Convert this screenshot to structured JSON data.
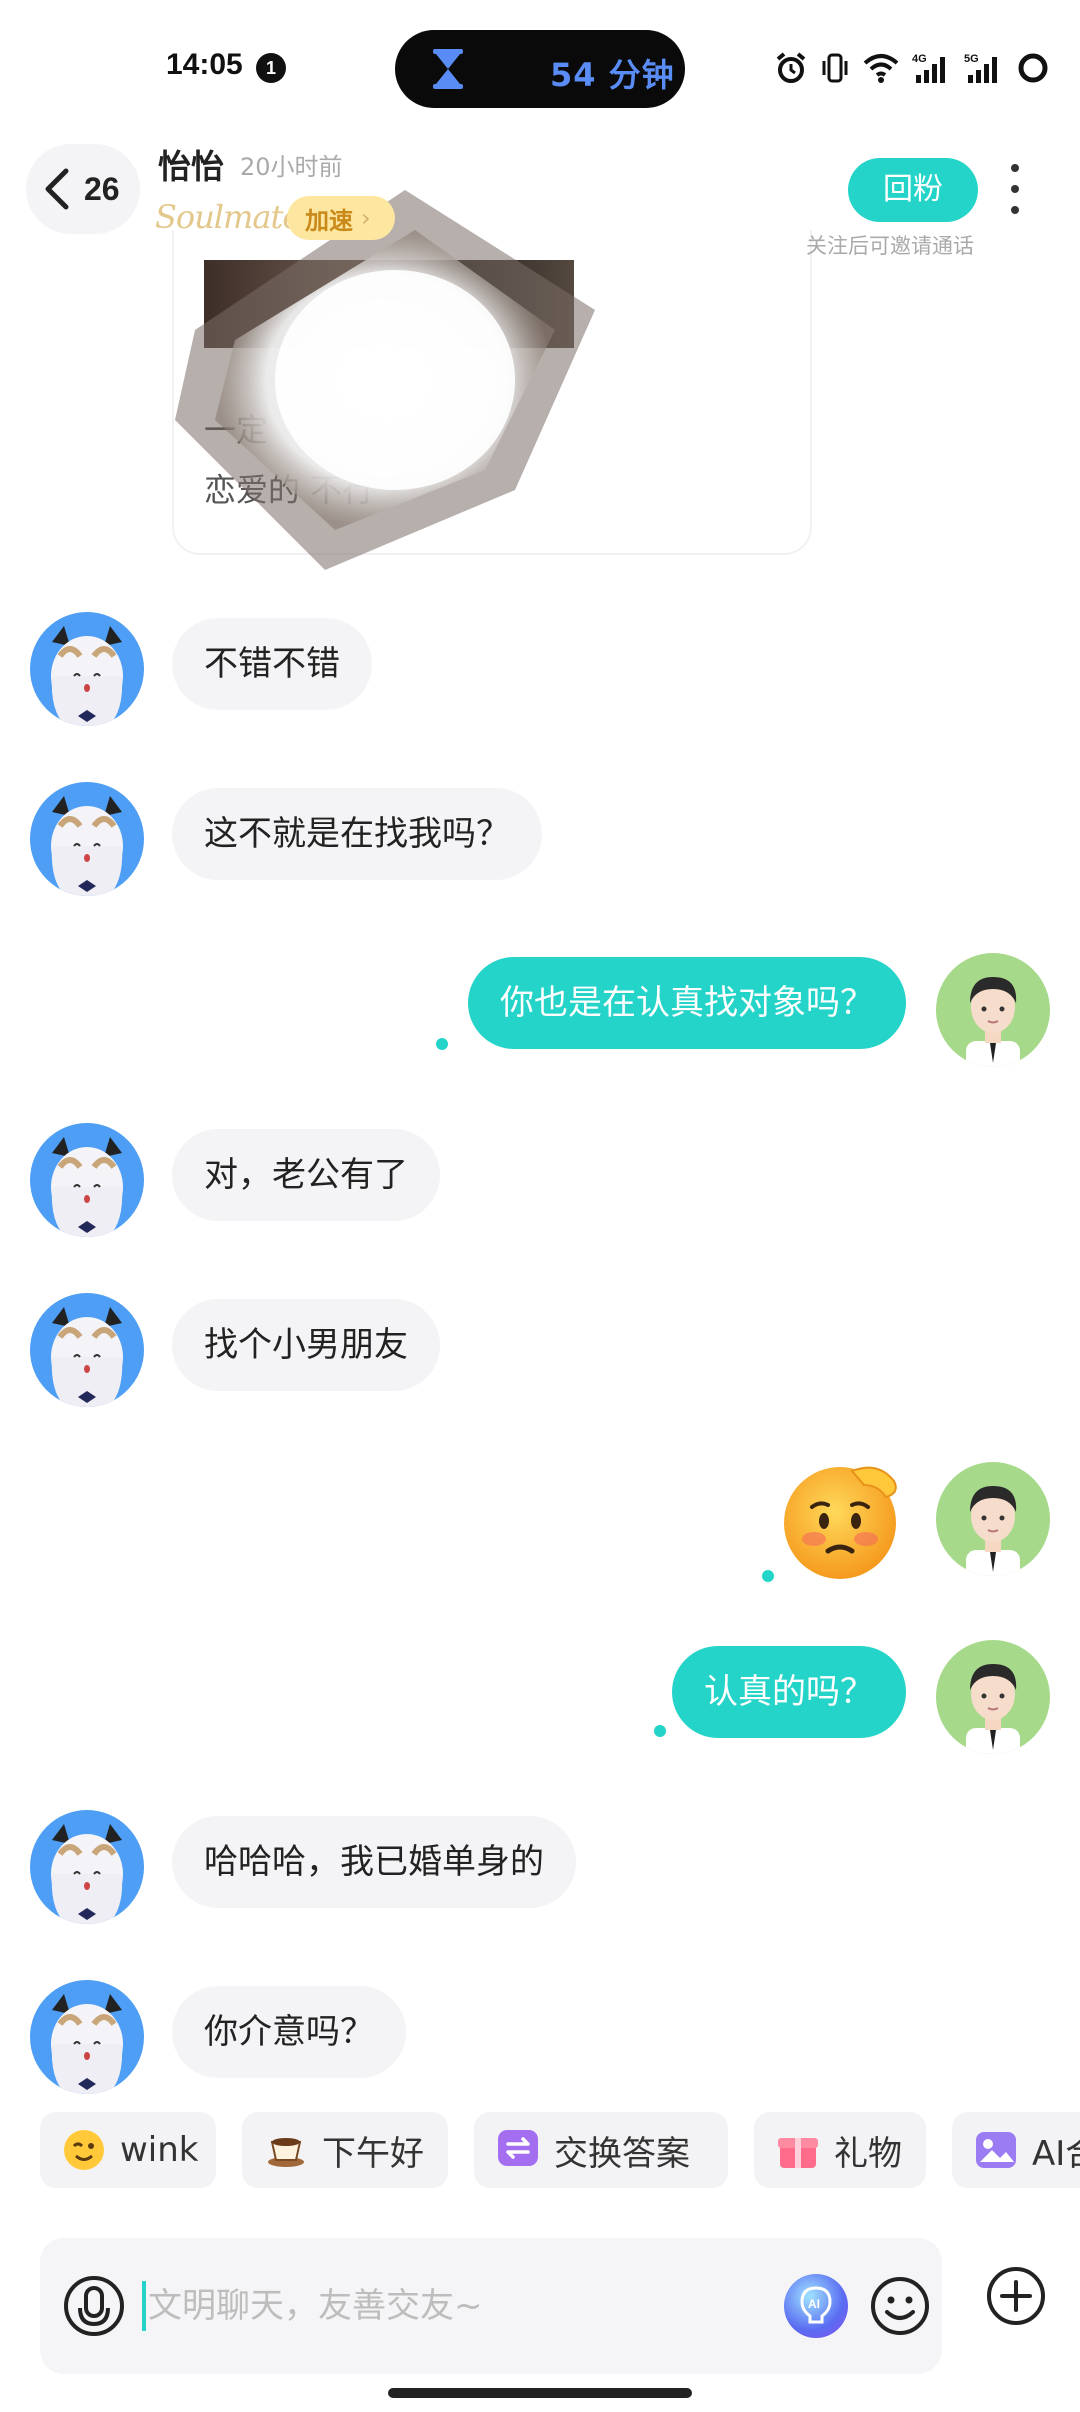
{
  "status_bar": {
    "time": "14:05",
    "notification_count": "1",
    "focus_timer": "54 分钟",
    "icons": [
      "alarm-icon",
      "vibrate-icon",
      "wifi-icon",
      "4g-signal-icon",
      "5g-signal-icon",
      "battery-icon"
    ]
  },
  "header": {
    "unread_count": "26",
    "contact_name": "怡怡",
    "last_seen": "20小时前",
    "soulmate_logo": "Soulmate",
    "boost_label": "加速",
    "follow_back_label": "回粉",
    "follow_hint": "关注后可邀请通话"
  },
  "shared_card": {
    "line1": "一定",
    "line2": "恋爱的                      不行"
  },
  "messages": [
    {
      "side": "in",
      "text": "不错不错"
    },
    {
      "side": "in",
      "text": "这不就是在找我吗？"
    },
    {
      "side": "out",
      "text": "你也是在认真找对象吗？"
    },
    {
      "side": "in",
      "text": "对，老公有了"
    },
    {
      "side": "in",
      "text": "找个小男朋友"
    },
    {
      "side": "out",
      "sticker": "worried-face-emoji"
    },
    {
      "side": "out",
      "text": "认真的吗？"
    },
    {
      "side": "in",
      "text": "哈哈哈，我已婚单身的"
    },
    {
      "side": "in",
      "text": "你介意吗？"
    }
  ],
  "quick_chips": [
    {
      "label": "wink",
      "icon": "wink-emoji-icon"
    },
    {
      "label": "下午好",
      "icon": "coffee-cup-icon"
    },
    {
      "label": "交换答案",
      "icon": "exchange-icon"
    },
    {
      "label": "礼物",
      "icon": "gift-icon"
    },
    {
      "label": "AI合",
      "icon": "ai-photo-icon"
    }
  ],
  "input": {
    "placeholder": "文明聊天，友善交友~",
    "value": ""
  },
  "colors": {
    "accent": "#25d4c8",
    "her_avatar_bg": "#4d9ef4",
    "my_avatar_bg": "#a7d98a",
    "incoming_bubble": "#f4f4f6",
    "boost_badge_bg": "#fde7a0"
  }
}
